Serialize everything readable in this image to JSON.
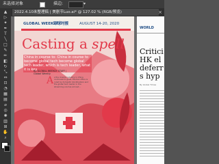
{
  "app": {
    "top_left_label": "未选择对象",
    "top_mid_label": "描边:",
    "tab_title": "2022.4.10未整理稿 | 美剧节Luo.ai* @ 127.02 % (RGB/预览)",
    "tab_close": "×"
  },
  "tools": [
    {
      "name": "selection-tool-icon",
      "glyph": "▲"
    },
    {
      "name": "direct-selection-tool-icon",
      "glyph": "▷"
    },
    {
      "name": "magic-wand-tool-icon",
      "glyph": "✦"
    },
    {
      "name": "pen-tool-icon",
      "glyph": "✒"
    },
    {
      "name": "type-tool-icon",
      "glyph": "T"
    },
    {
      "name": "line-tool-icon",
      "glyph": "╲"
    },
    {
      "name": "rectangle-tool-icon",
      "glyph": "□"
    },
    {
      "name": "paintbrush-tool-icon",
      "glyph": "✎"
    },
    {
      "name": "pencil-tool-icon",
      "glyph": "✏"
    },
    {
      "name": "eraser-tool-icon",
      "glyph": "◧"
    },
    {
      "name": "rotate-tool-icon",
      "glyph": "↻"
    },
    {
      "name": "scale-tool-icon",
      "glyph": "⤡"
    },
    {
      "name": "width-tool-icon",
      "glyph": "⇔"
    },
    {
      "name": "free-transform-tool-icon",
      "glyph": "⊡"
    },
    {
      "name": "shape-builder-tool-icon",
      "glyph": "◔"
    },
    {
      "name": "perspective-tool-icon",
      "glyph": "▦"
    },
    {
      "name": "gradient-tool-icon",
      "glyph": "▤"
    },
    {
      "name": "eyedropper-tool-icon",
      "glyph": "⌀"
    },
    {
      "name": "blend-tool-icon",
      "glyph": "◎"
    },
    {
      "name": "symbol-sprayer-tool-icon",
      "glyph": "✺"
    },
    {
      "name": "graph-tool-icon",
      "glyph": "▥"
    },
    {
      "name": "artboard-tool-icon",
      "glyph": "⊞"
    },
    {
      "name": "hand-tool-icon",
      "glyph": "✋"
    },
    {
      "name": "zoom-tool-icon",
      "glyph": "⌕"
    }
  ],
  "document": {
    "section": "GLOBAL WEEKLY",
    "cn_logo": "环球时报",
    "date": "AUGUST 14-20, 2020",
    "headline_main": "Casting a ",
    "headline_italic": "spell",
    "deck": "China in course to: China in course to become global tech become global tech leader, which is tech leader, what it is key",
    "byline": "By GLOBAL WEEKLY STAFF | Global Weekly",
    "dropcap": "A",
    "body": "s the cinema industry in China continues to grow, the box office is ruled by domestic blockbusters and the global tech leader in the streaming era has arrived..."
  },
  "side_page": {
    "header": "WORLD",
    "headline": "Critici HK el deferr s hyp",
    "sub": "By Global Times"
  },
  "colors": {
    "accent": "#e2394a",
    "brand_blue": "#1f4d86",
    "page_bg": "#f4efe9",
    "app_bg": "#535353"
  }
}
